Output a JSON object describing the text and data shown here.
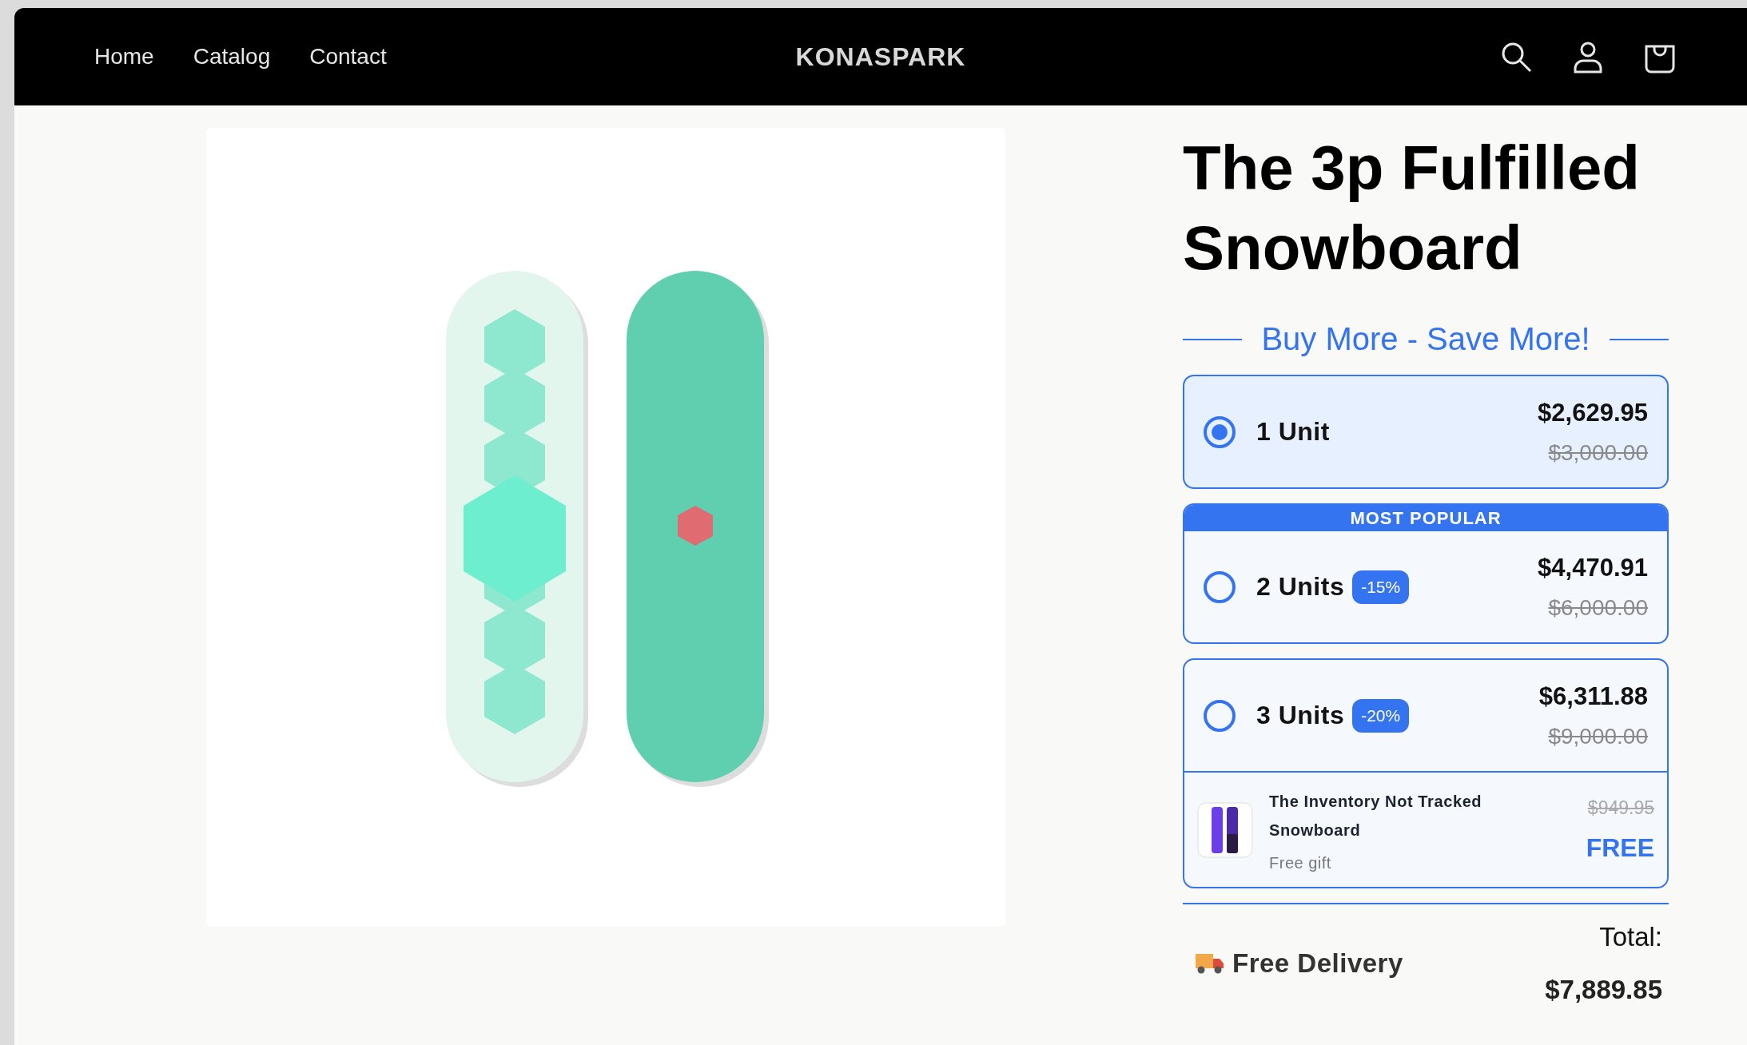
{
  "header": {
    "nav": [
      {
        "label": "Home"
      },
      {
        "label": "Catalog"
      },
      {
        "label": "Contact"
      }
    ],
    "logo": "KONASPARK"
  },
  "product": {
    "title": "The 3p Fulfilled Snowboard"
  },
  "bundle": {
    "heading": "Buy More - Save More!",
    "options": [
      {
        "label": "1 Unit",
        "selected": true,
        "price": "$2,629.95",
        "compare_price": "$3,000.00"
      },
      {
        "label": "2 Units",
        "selected": false,
        "badge": "-15%",
        "ribbon": "MOST POPULAR",
        "price": "$4,470.91",
        "compare_price": "$6,000.00"
      },
      {
        "label": "3 Units",
        "selected": false,
        "badge": "-20%",
        "price": "$6,311.88",
        "compare_price": "$9,000.00",
        "gift": {
          "name": "The Inventory Not Tracked Snowboard",
          "note": "Free gift",
          "compare_price": "$949.95",
          "price": "FREE"
        }
      }
    ]
  },
  "delivery": {
    "label": "Free Delivery"
  },
  "total": {
    "label": "Total:",
    "amount": "$7,889.85"
  }
}
